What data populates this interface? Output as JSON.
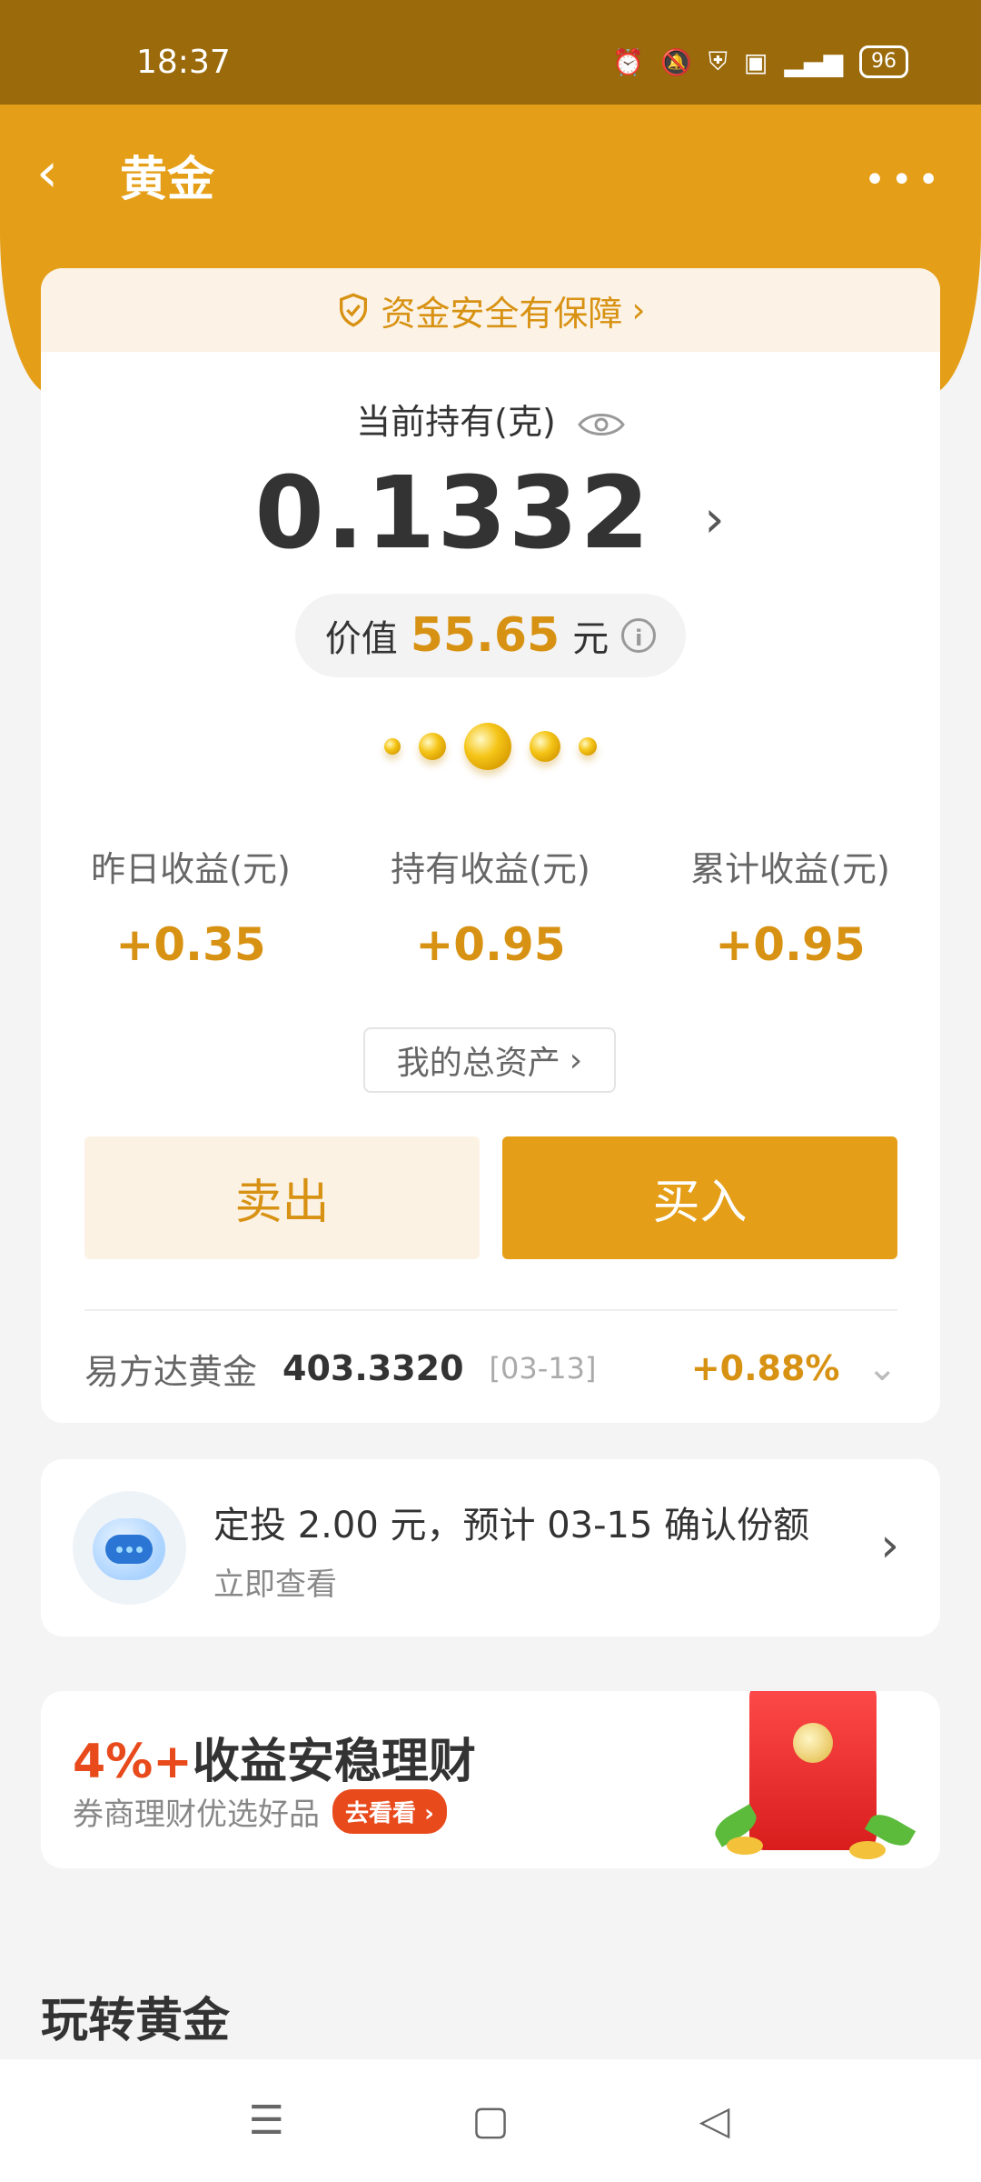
{
  "status": {
    "time": "18:37",
    "battery": "96"
  },
  "header": {
    "title": "黄金"
  },
  "main": {
    "safety": "资金安全有保障",
    "holding_label": "当前持有(克)",
    "holding_amount": "0.1332",
    "value_label": "价值",
    "value_amount": "55.65",
    "value_unit": "元",
    "stats": [
      {
        "label": "昨日收益(元)",
        "value": "+0.35"
      },
      {
        "label": "持有收益(元)",
        "value": "+0.95"
      },
      {
        "label": "累计收益(元)",
        "value": "+0.95"
      }
    ],
    "total_assets": "我的总资产",
    "sell": "卖出",
    "buy": "买入",
    "fund": {
      "name": "易方达黄金",
      "nav": "403.3320",
      "date": "[03-13]",
      "change": "+0.88%"
    }
  },
  "plan": {
    "title": "定投 2.00 元，预计 03-15 确认份额",
    "subtitle": "立即查看"
  },
  "promo": {
    "title_highlight": "4%+",
    "title_rest": "收益安稳理财",
    "subtitle": "券商理财优选好品",
    "button": "去看看"
  },
  "section": {
    "title": "玩转黄金"
  },
  "colors": {
    "accent": "#e59e17",
    "gold_text": "#d89213",
    "promo_red": "#e84a1c"
  }
}
